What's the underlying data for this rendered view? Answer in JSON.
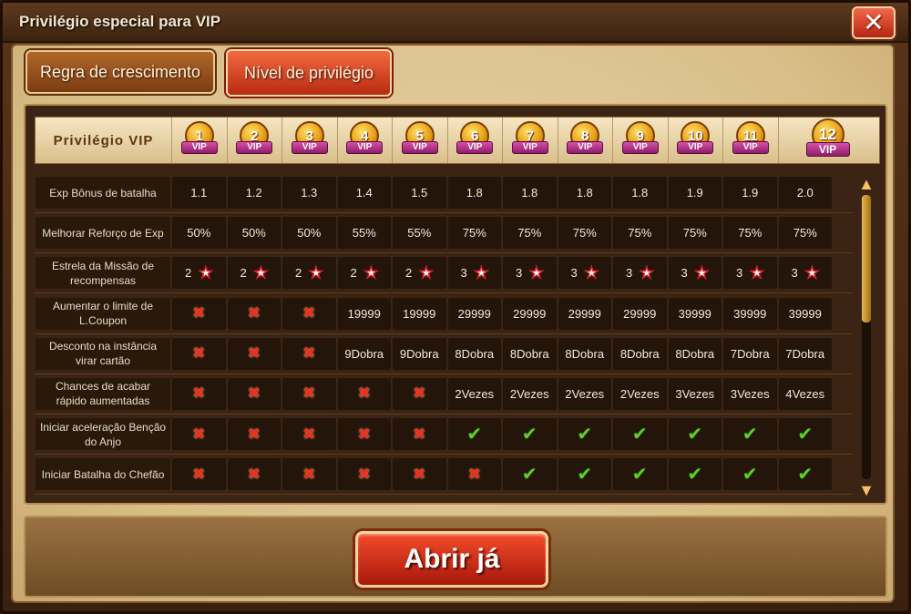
{
  "window": {
    "title": "Privilégio especial para VIP"
  },
  "tabs": [
    {
      "label": "Regra de crescimento",
      "active": false
    },
    {
      "label": "Nível de privilégio",
      "active": true
    }
  ],
  "table": {
    "header_label": "Privilégio VIP",
    "vip_levels": [
      "1",
      "2",
      "3",
      "4",
      "5",
      "6",
      "7",
      "8",
      "9",
      "10",
      "11",
      "12"
    ],
    "vip_ribbon": "VIP",
    "rows": [
      {
        "label": "Exp Bônus de batalha",
        "values": [
          "1.1",
          "1.2",
          "1.3",
          "1.4",
          "1.5",
          "1.8",
          "1.8",
          "1.8",
          "1.8",
          "1.9",
          "1.9",
          "2.0"
        ]
      },
      {
        "label": "Melhorar Reforço de Exp",
        "values": [
          "50%",
          "50%",
          "50%",
          "55%",
          "55%",
          "75%",
          "75%",
          "75%",
          "75%",
          "75%",
          "75%",
          "75%"
        ]
      },
      {
        "label": "Estrela da Missão de recompensas",
        "values": [
          "2",
          "2",
          "2",
          "2",
          "2",
          "3",
          "3",
          "3",
          "3",
          "3",
          "3",
          "3"
        ],
        "type": "star"
      },
      {
        "label": "Aumentar o limite de L.Coupon",
        "values": [
          "x",
          "x",
          "x",
          "19999",
          "19999",
          "29999",
          "29999",
          "29999",
          "29999",
          "39999",
          "39999",
          "39999"
        ]
      },
      {
        "label": "Desconto na instância virar cartão",
        "values": [
          "x",
          "x",
          "x",
          "9Dobra",
          "9Dobra",
          "8Dobra",
          "8Dobra",
          "8Dobra",
          "8Dobra",
          "8Dobra",
          "7Dobra",
          "7Dobra"
        ]
      },
      {
        "label": "Chances de acabar rápido aumentadas",
        "values": [
          "x",
          "x",
          "x",
          "x",
          "x",
          "2Vezes",
          "2Vezes",
          "2Vezes",
          "2Vezes",
          "3Vezes",
          "3Vezes",
          "4Vezes"
        ]
      },
      {
        "label": "Iniciar aceleração Benção do Anjo",
        "values": [
          "x",
          "x",
          "x",
          "x",
          "x",
          "check",
          "check",
          "check",
          "check",
          "check",
          "check",
          "check"
        ]
      },
      {
        "label": "Iniciar Batalha do Chefão",
        "values": [
          "x",
          "x",
          "x",
          "x",
          "x",
          "x",
          "check",
          "check",
          "check",
          "check",
          "check",
          "check"
        ]
      }
    ]
  },
  "scroll": {
    "position": 0.0
  },
  "actions": {
    "open_label": "Abrir já",
    "close_icon": "close-icon"
  },
  "colors": {
    "accent_red": "#d8202a",
    "check_green": "#5fd02a",
    "gold": "#e59b12"
  }
}
